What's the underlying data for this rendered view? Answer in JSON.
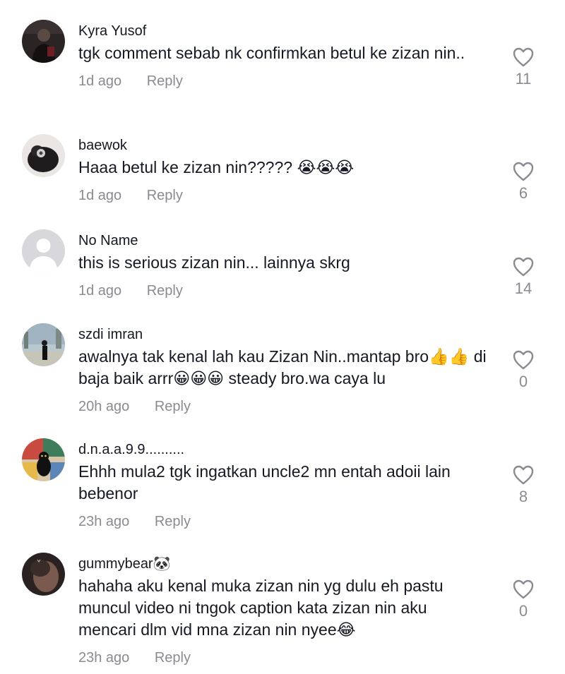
{
  "colors": {
    "text": "#161823",
    "muted": "#8a8b91",
    "background": "#ffffff"
  },
  "comments": [
    {
      "username": "Kyra Yusof",
      "text": "tgk comment sebab nk confirmkan betul ke zizan nin..",
      "time": "1d ago",
      "reply": "Reply",
      "likes": "11",
      "avatar": "photo-dark-person"
    },
    {
      "username": "baewok",
      "text": "Haaa betul ke zizan nin????? 😭😭😭",
      "time": "1d ago",
      "reply": "Reply",
      "likes": "6",
      "avatar": "photo-cat"
    },
    {
      "username": "No Name",
      "text": "this is serious zizan nin... lainnya skrg",
      "time": "1d ago",
      "reply": "Reply",
      "likes": "14",
      "avatar": "default-avatar"
    },
    {
      "username": "szdi imran",
      "text": "awalnya tak kenal lah kau Zizan Nin..mantap bro👍👍 di baja baik arrr😀😀😀 steady bro.wa caya lu",
      "time": "20h ago",
      "reply": "Reply",
      "likes": "0",
      "avatar": "photo-city"
    },
    {
      "username": "d.n.a.a.9.9..........",
      "text": "Ehhh mula2 tgk ingatkan uncle2 mn entah adoii lain bebenor",
      "time": "23h ago",
      "reply": "Reply",
      "likes": "8",
      "avatar": "photo-art-cat"
    },
    {
      "username": "gummybear🐼",
      "text": "hahaha aku kenal muka zizan nin yg dulu eh pastu muncul video ni tngok caption kata zizan nin aku mencari dlm vid mna zizan nin nyee😂",
      "time": "23h ago",
      "reply": "Reply",
      "likes": "0",
      "avatar": "photo-face"
    }
  ]
}
